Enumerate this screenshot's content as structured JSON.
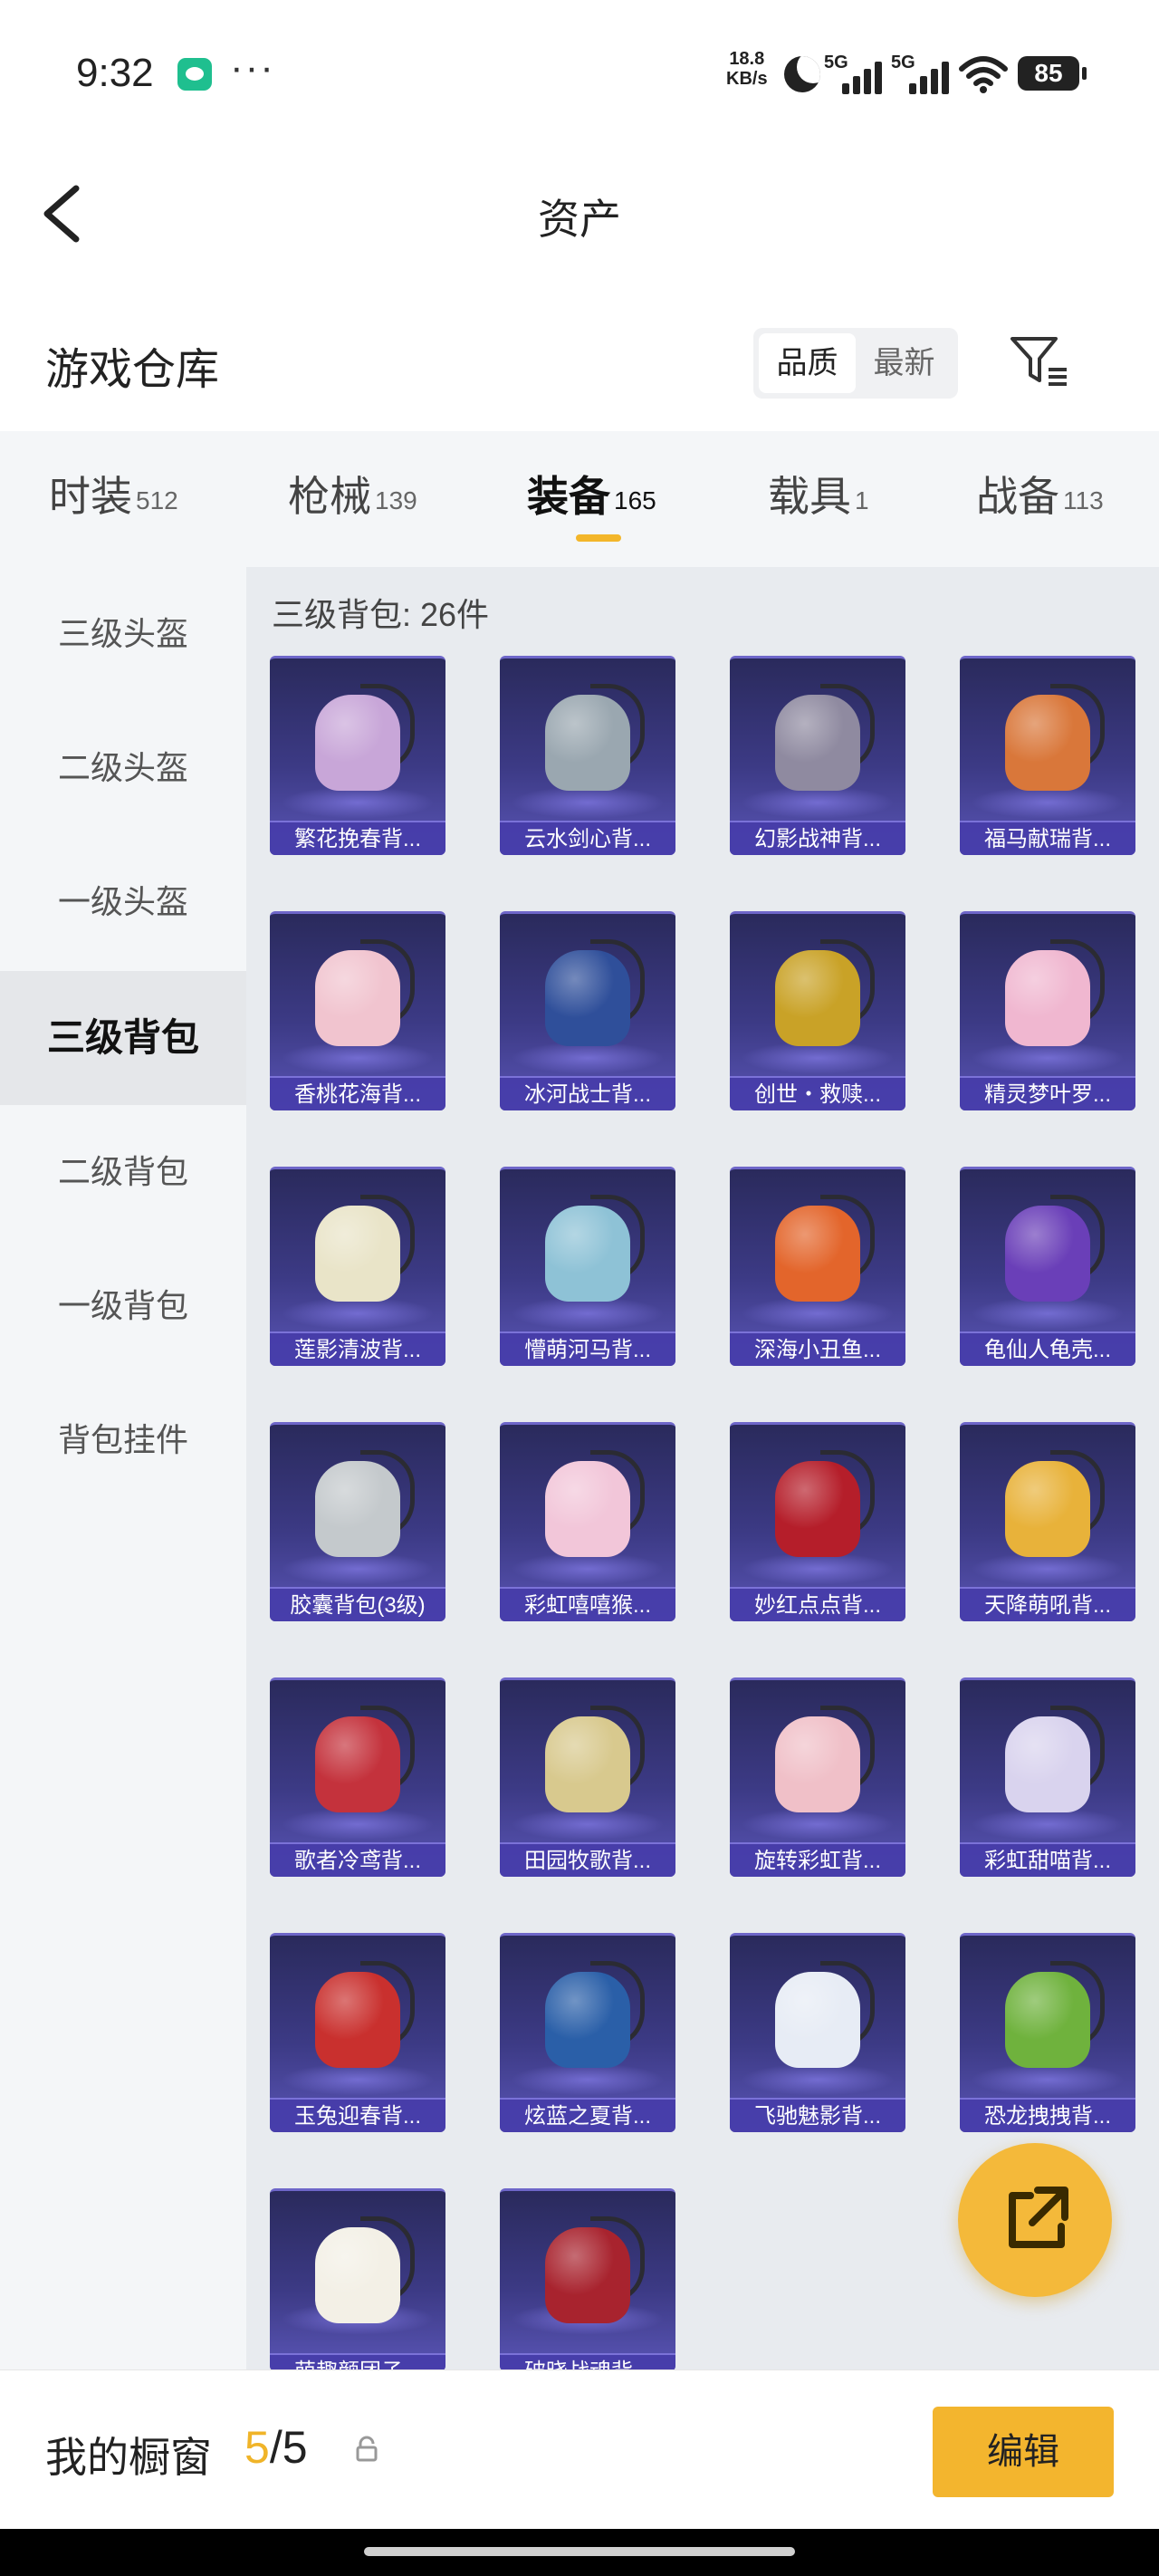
{
  "status_bar": {
    "time": "9:32",
    "net_speed_value": "18.8",
    "net_speed_unit": "KB/s",
    "signal_1": "5G",
    "signal_2": "5G",
    "battery": "85"
  },
  "header": {
    "title": "资产"
  },
  "warehouse": {
    "title": "游戏仓库",
    "sort_options": [
      "品质",
      "最新"
    ]
  },
  "tabs": [
    {
      "name": "时装",
      "count": "512"
    },
    {
      "name": "枪械",
      "count": "139"
    },
    {
      "name": "装备",
      "count": "165"
    },
    {
      "name": "载具",
      "count": "1"
    },
    {
      "name": "战备",
      "count": "113"
    }
  ],
  "sidebar": {
    "items": [
      "三级头盔",
      "二级头盔",
      "一级头盔",
      "三级背包",
      "二级背包",
      "一级背包",
      "背包挂件"
    ],
    "active_index": 3
  },
  "content": {
    "section_label": "三级背包: 26件",
    "items": [
      {
        "name": "繁花挽春背...",
        "color": "#c8a6d8"
      },
      {
        "name": "云水剑心背...",
        "color": "#9aa7b0"
      },
      {
        "name": "幻影战神背...",
        "color": "#8f8aa0"
      },
      {
        "name": "福马献瑞背...",
        "color": "#d9773a"
      },
      {
        "name": "香桃花海背...",
        "color": "#f1c4cf"
      },
      {
        "name": "冰河战士背...",
        "color": "#2f4f9a"
      },
      {
        "name": "创世・救赎...",
        "color": "#c9a227"
      },
      {
        "name": "精灵梦叶罗...",
        "color": "#f0b7d0"
      },
      {
        "name": "莲影清波背...",
        "color": "#e9e4c8"
      },
      {
        "name": "懵萌河马背...",
        "color": "#8ec2d6"
      },
      {
        "name": "深海小丑鱼...",
        "color": "#e3652b"
      },
      {
        "name": "龟仙人龟壳...",
        "color": "#6a3fb8"
      },
      {
        "name": "胶囊背包(3级)",
        "color": "#c4c9cc"
      },
      {
        "name": "彩虹嘻嘻猴...",
        "color": "#f2c6d9"
      },
      {
        "name": "妙红点点背...",
        "color": "#b51e2a"
      },
      {
        "name": "天降萌吼背...",
        "color": "#e8b23a"
      },
      {
        "name": "歌者冷鸢背...",
        "color": "#c4323c"
      },
      {
        "name": "田园牧歌背...",
        "color": "#d8c98e"
      },
      {
        "name": "旋转彩虹背...",
        "color": "#f0c0c8"
      },
      {
        "name": "彩虹甜喵背...",
        "color": "#d9d3ee"
      },
      {
        "name": "玉兔迎春背...",
        "color": "#c9302e"
      },
      {
        "name": "炫蓝之夏背...",
        "color": "#2a5fa8"
      },
      {
        "name": "飞驰魅影背...",
        "color": "#e7ecf5"
      },
      {
        "name": "恐龙拽拽背...",
        "color": "#6fb23d"
      },
      {
        "name": "萌趣颜团子...",
        "color": "#f3f0e6"
      },
      {
        "name": "破晓战魂背...",
        "color": "#a8232e"
      }
    ]
  },
  "bottom_bar": {
    "label": "我的橱窗",
    "current": "5",
    "separator": "/",
    "total": "5",
    "edit_label": "编辑"
  },
  "colors": {
    "accent": "#f3b52e",
    "card_bg": "#3c3a85"
  }
}
